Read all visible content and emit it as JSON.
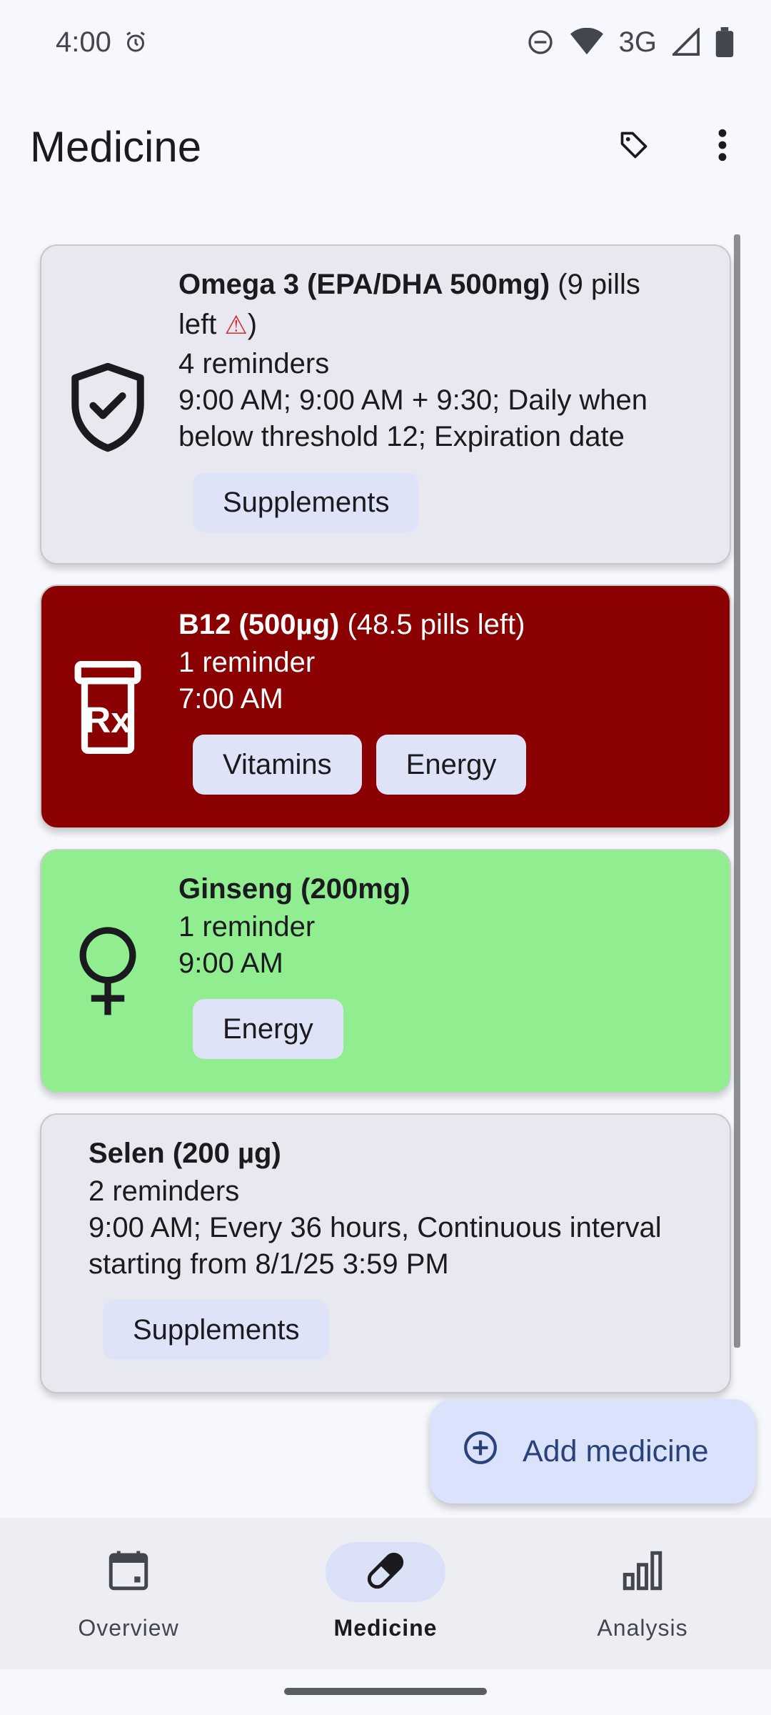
{
  "status_bar": {
    "time": "4:00",
    "network": "3G",
    "icons": [
      "alarm-icon",
      "do-not-disturb-icon",
      "wifi-icon",
      "cell-signal-icon",
      "battery-icon"
    ]
  },
  "app_bar": {
    "title": "Medicine",
    "actions": [
      "tag-icon",
      "more-vert-icon"
    ]
  },
  "medicines": [
    {
      "name": "Omega 3 (EPA/DHA 500mg)",
      "pills_left_open": " (9 pills",
      "pills_left_cont": "left ",
      "warning_glyph": "⚠",
      "pills_left_close": ")",
      "reminders": "4 reminders",
      "schedule": "9:00 AM; 9:00 AM + 9:30; Daily when below threshold 12; Expiration date",
      "tags": [
        "Supplements"
      ],
      "icon": "shield-check-icon",
      "color": "#e8e8f1"
    },
    {
      "name": "B12 (500µg)",
      "pills_left": " (48.5 pills left)",
      "reminders": "1 reminder",
      "schedule": "7:00 AM",
      "tags": [
        "Vitamins",
        "Energy"
      ],
      "icon": "prescription-bottle-icon",
      "color": "#8b0000"
    },
    {
      "name": "Ginseng (200mg)",
      "reminders": "1 reminder",
      "schedule": "9:00 AM",
      "tags": [
        "Energy"
      ],
      "icon": "female-symbol-icon",
      "color": "#90ee90"
    },
    {
      "name": "Selen (200 µg)",
      "reminders": "2 reminders",
      "schedule": "9:00 AM; Every 36 hours, Continuous interval starting from 8/1/25 3:59 PM",
      "tags": [
        "Supplements"
      ],
      "color": "#e8e8f1"
    }
  ],
  "fab": {
    "label": "Add medicine",
    "icon": "add-circle-icon"
  },
  "bottom_nav": [
    {
      "label": "Overview",
      "icon": "calendar-icon",
      "active": false
    },
    {
      "label": "Medicine",
      "icon": "pill-icon",
      "active": true
    },
    {
      "label": "Analysis",
      "icon": "bar-chart-icon",
      "active": false
    }
  ]
}
